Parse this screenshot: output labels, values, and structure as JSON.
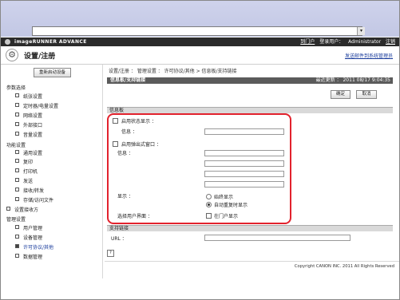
{
  "browser": {
    "url": ""
  },
  "topbar": {
    "brand": "imageRUNNER ADVANCE",
    "portal": "到门户",
    "login_label": "登录用户：",
    "user": "Administrator",
    "logout": "注销"
  },
  "header": {
    "title": "设置/注册",
    "link": "发送邮件到系统管理员"
  },
  "sidebar": {
    "restart_button": "重新启动设备",
    "sections": [
      {
        "title": "参数选择",
        "items": [
          "纸张设置",
          "定时器/电量设置",
          "网络设置",
          "外部接口",
          "音量设置"
        ]
      },
      {
        "title": "功能设置",
        "items": [
          "通用设置",
          "复印",
          "打印机",
          "发送",
          "接收/转发",
          "存储/访问文件"
        ]
      },
      {
        "title": "设置接收方",
        "items": []
      },
      {
        "title": "管理设置",
        "items": [
          "用户管理",
          "设备管理",
          "许可协议/其他",
          "数据管理"
        ]
      }
    ]
  },
  "main": {
    "breadcrumb": "设置/注册 ： 管理设置 ： 许可协议/其他 > 信息板/支持链接",
    "page_header": "信息板/支持链接",
    "last_updated": "最近更新 ： 2011 08/17 9:04:35",
    "ok_button": "确定",
    "cancel_button": "取消",
    "info_section": "信息板",
    "status_display": "启用状态显示 ：",
    "info_label_1": "信息 ：",
    "popup_window": "启用弹出式窗口 ：",
    "info_label_2": "信息 ：",
    "display_label": "显示 ：",
    "option_always": "始终显示",
    "option_auto": "自动重复时显示",
    "select_user_page": "选择用户界面 ：",
    "portal_display": "在门户显示",
    "support_section": "支持链接",
    "url_label": "URL ：",
    "help_icon_glyph": "?"
  },
  "footer": "Copyright CANON INC. 2011 All Rights Reserved",
  "colors": {
    "highlight": "#e2222d",
    "header_bar": "#5b5b5b",
    "topbar": "#2b2b2b"
  }
}
